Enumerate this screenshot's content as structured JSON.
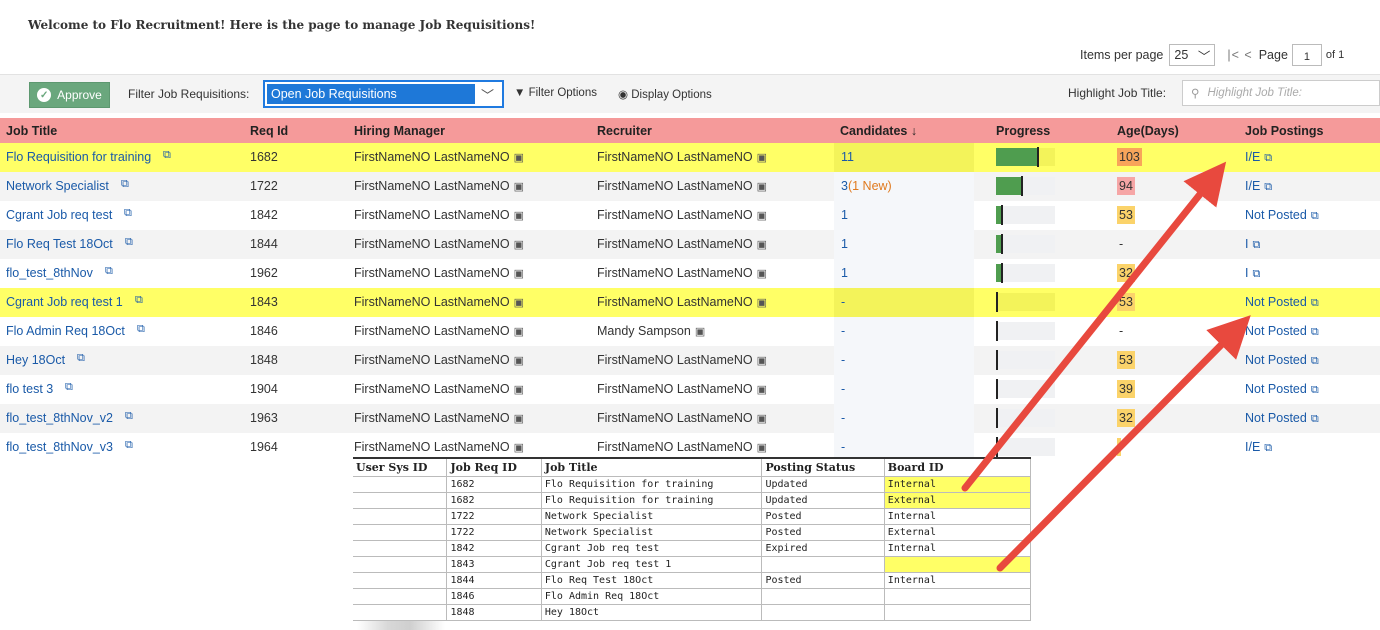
{
  "welcome": "Welcome to Flo Recruitment! Here is the page to manage Job Requisitions!",
  "pager": {
    "items_label": "Items per page",
    "items_value": "25",
    "page_label": "Page",
    "page_value": "1",
    "of_label": "of 1"
  },
  "toolbar": {
    "approve": "Approve",
    "filter_label": "Filter Job Requisitions:",
    "filter_value": "Open Job Requisitions",
    "filter_options": "Filter Options",
    "display_options": "Display Options",
    "highlight_label": "Highlight Job Title:",
    "highlight_placeholder": "Highlight Job Title:"
  },
  "columns": [
    "Job Title",
    "Req Id",
    "Hiring Manager",
    "Recruiter",
    "Candidates ↓",
    "Progress",
    "Age(Days)",
    "Job Postings"
  ],
  "rows": [
    {
      "title": "Flo Requisition for training",
      "req": "1682",
      "hm": "FirstNameNO LastNameNO",
      "rec": "FirstNameNO LastNameNO",
      "cand": "11",
      "cand_new": "",
      "progress": 0.82,
      "age": "103",
      "age_color": "#f8a55a",
      "post": "I/E",
      "hl": true
    },
    {
      "title": "Network Specialist",
      "req": "1722",
      "hm": "FirstNameNO LastNameNO",
      "rec": "FirstNameNO LastNameNO",
      "cand": "3",
      "cand_new": "(1 New)",
      "progress": 0.5,
      "age": "94",
      "age_color": "#f6a6a6",
      "post": "I/E",
      "hl": false
    },
    {
      "title": "Cgrant Job req test",
      "req": "1842",
      "hm": "FirstNameNO LastNameNO",
      "rec": "FirstNameNO LastNameNO",
      "cand": "1",
      "cand_new": "",
      "progress": 0.1,
      "age": "53",
      "age_color": "#fbd36a",
      "post": "Not Posted",
      "hl": false
    },
    {
      "title": "Flo Req Test 18Oct",
      "req": "1844",
      "hm": "FirstNameNO LastNameNO",
      "rec": "FirstNameNO LastNameNO",
      "cand": "1",
      "cand_new": "",
      "progress": 0.1,
      "age": "-",
      "age_color": "",
      "post": "I",
      "hl": false
    },
    {
      "title": "flo_test_8thNov",
      "req": "1962",
      "hm": "FirstNameNO LastNameNO",
      "rec": "FirstNameNO LastNameNO",
      "cand": "1",
      "cand_new": "",
      "progress": 0.1,
      "age": "32",
      "age_color": "#fbd36a",
      "post": "I",
      "hl": false
    },
    {
      "title": "Cgrant Job req test 1",
      "req": "1843",
      "hm": "FirstNameNO LastNameNO",
      "rec": "FirstNameNO LastNameNO",
      "cand": "-",
      "cand_new": "",
      "progress": 0,
      "age": "53",
      "age_color": "#fbd36a",
      "post": "Not Posted",
      "hl": true
    },
    {
      "title": "Flo Admin Req 18Oct",
      "req": "1846",
      "hm": "FirstNameNO LastNameNO",
      "rec": "Mandy Sampson",
      "cand": "-",
      "cand_new": "",
      "progress": 0,
      "age": "-",
      "age_color": "",
      "post": "Not Posted",
      "hl": false
    },
    {
      "title": "Hey 18Oct",
      "req": "1848",
      "hm": "FirstNameNO LastNameNO",
      "rec": "FirstNameNO LastNameNO",
      "cand": "-",
      "cand_new": "",
      "progress": 0,
      "age": "53",
      "age_color": "#fbd36a",
      "post": "Not Posted",
      "hl": false
    },
    {
      "title": "flo test 3",
      "req": "1904",
      "hm": "FirstNameNO LastNameNO",
      "rec": "FirstNameNO LastNameNO",
      "cand": "-",
      "cand_new": "",
      "progress": 0,
      "age": "39",
      "age_color": "#fbd36a",
      "post": "Not Posted",
      "hl": false
    },
    {
      "title": "flo_test_8thNov_v2",
      "req": "1963",
      "hm": "FirstNameNO LastNameNO",
      "rec": "FirstNameNO LastNameNO",
      "cand": "-",
      "cand_new": "",
      "progress": 0,
      "age": "32",
      "age_color": "#fbd36a",
      "post": "Not Posted",
      "hl": false
    },
    {
      "title": "flo_test_8thNov_v3",
      "req": "1964",
      "hm": "FirstNameNO LastNameNO",
      "rec": "FirstNameNO LastNameNO",
      "cand": "-",
      "cand_new": "",
      "progress": 0,
      "age": "",
      "age_color": "#fbd36a",
      "post": "I/E",
      "hl": false
    }
  ],
  "db_table": {
    "headers": [
      "User Sys ID",
      "Job Req ID",
      "Job Title",
      "Posting Status",
      "Board ID"
    ],
    "rows": [
      [
        "",
        "1682",
        "Flo Requisition for training",
        "Updated",
        "Internal"
      ],
      [
        "",
        "1682",
        "Flo Requisition for training",
        "Updated",
        "External"
      ],
      [
        "",
        "1722",
        "Network Specialist",
        "Posted",
        "Internal"
      ],
      [
        "",
        "1722",
        "Network Specialist",
        "Posted",
        "External"
      ],
      [
        "",
        "1842",
        "Cgrant Job req test",
        "Expired",
        "Internal"
      ],
      [
        "",
        "1843",
        "Cgrant Job req test 1",
        "",
        ""
      ],
      [
        "",
        "1844",
        "Flo Req Test 18Oct",
        "Posted",
        "Internal"
      ],
      [
        "",
        "1846",
        "Flo Admin Req 18Oct",
        "",
        ""
      ],
      [
        "",
        "1848",
        "Hey 18Oct",
        "",
        ""
      ]
    ],
    "highlight_board_rows": [
      0,
      1,
      5
    ]
  },
  "colors": {
    "header": "#f59a9a",
    "highlight": "#ffff66",
    "link": "#1a5aa8",
    "approve": "#6aa77d",
    "arrow": "#e8493e"
  }
}
